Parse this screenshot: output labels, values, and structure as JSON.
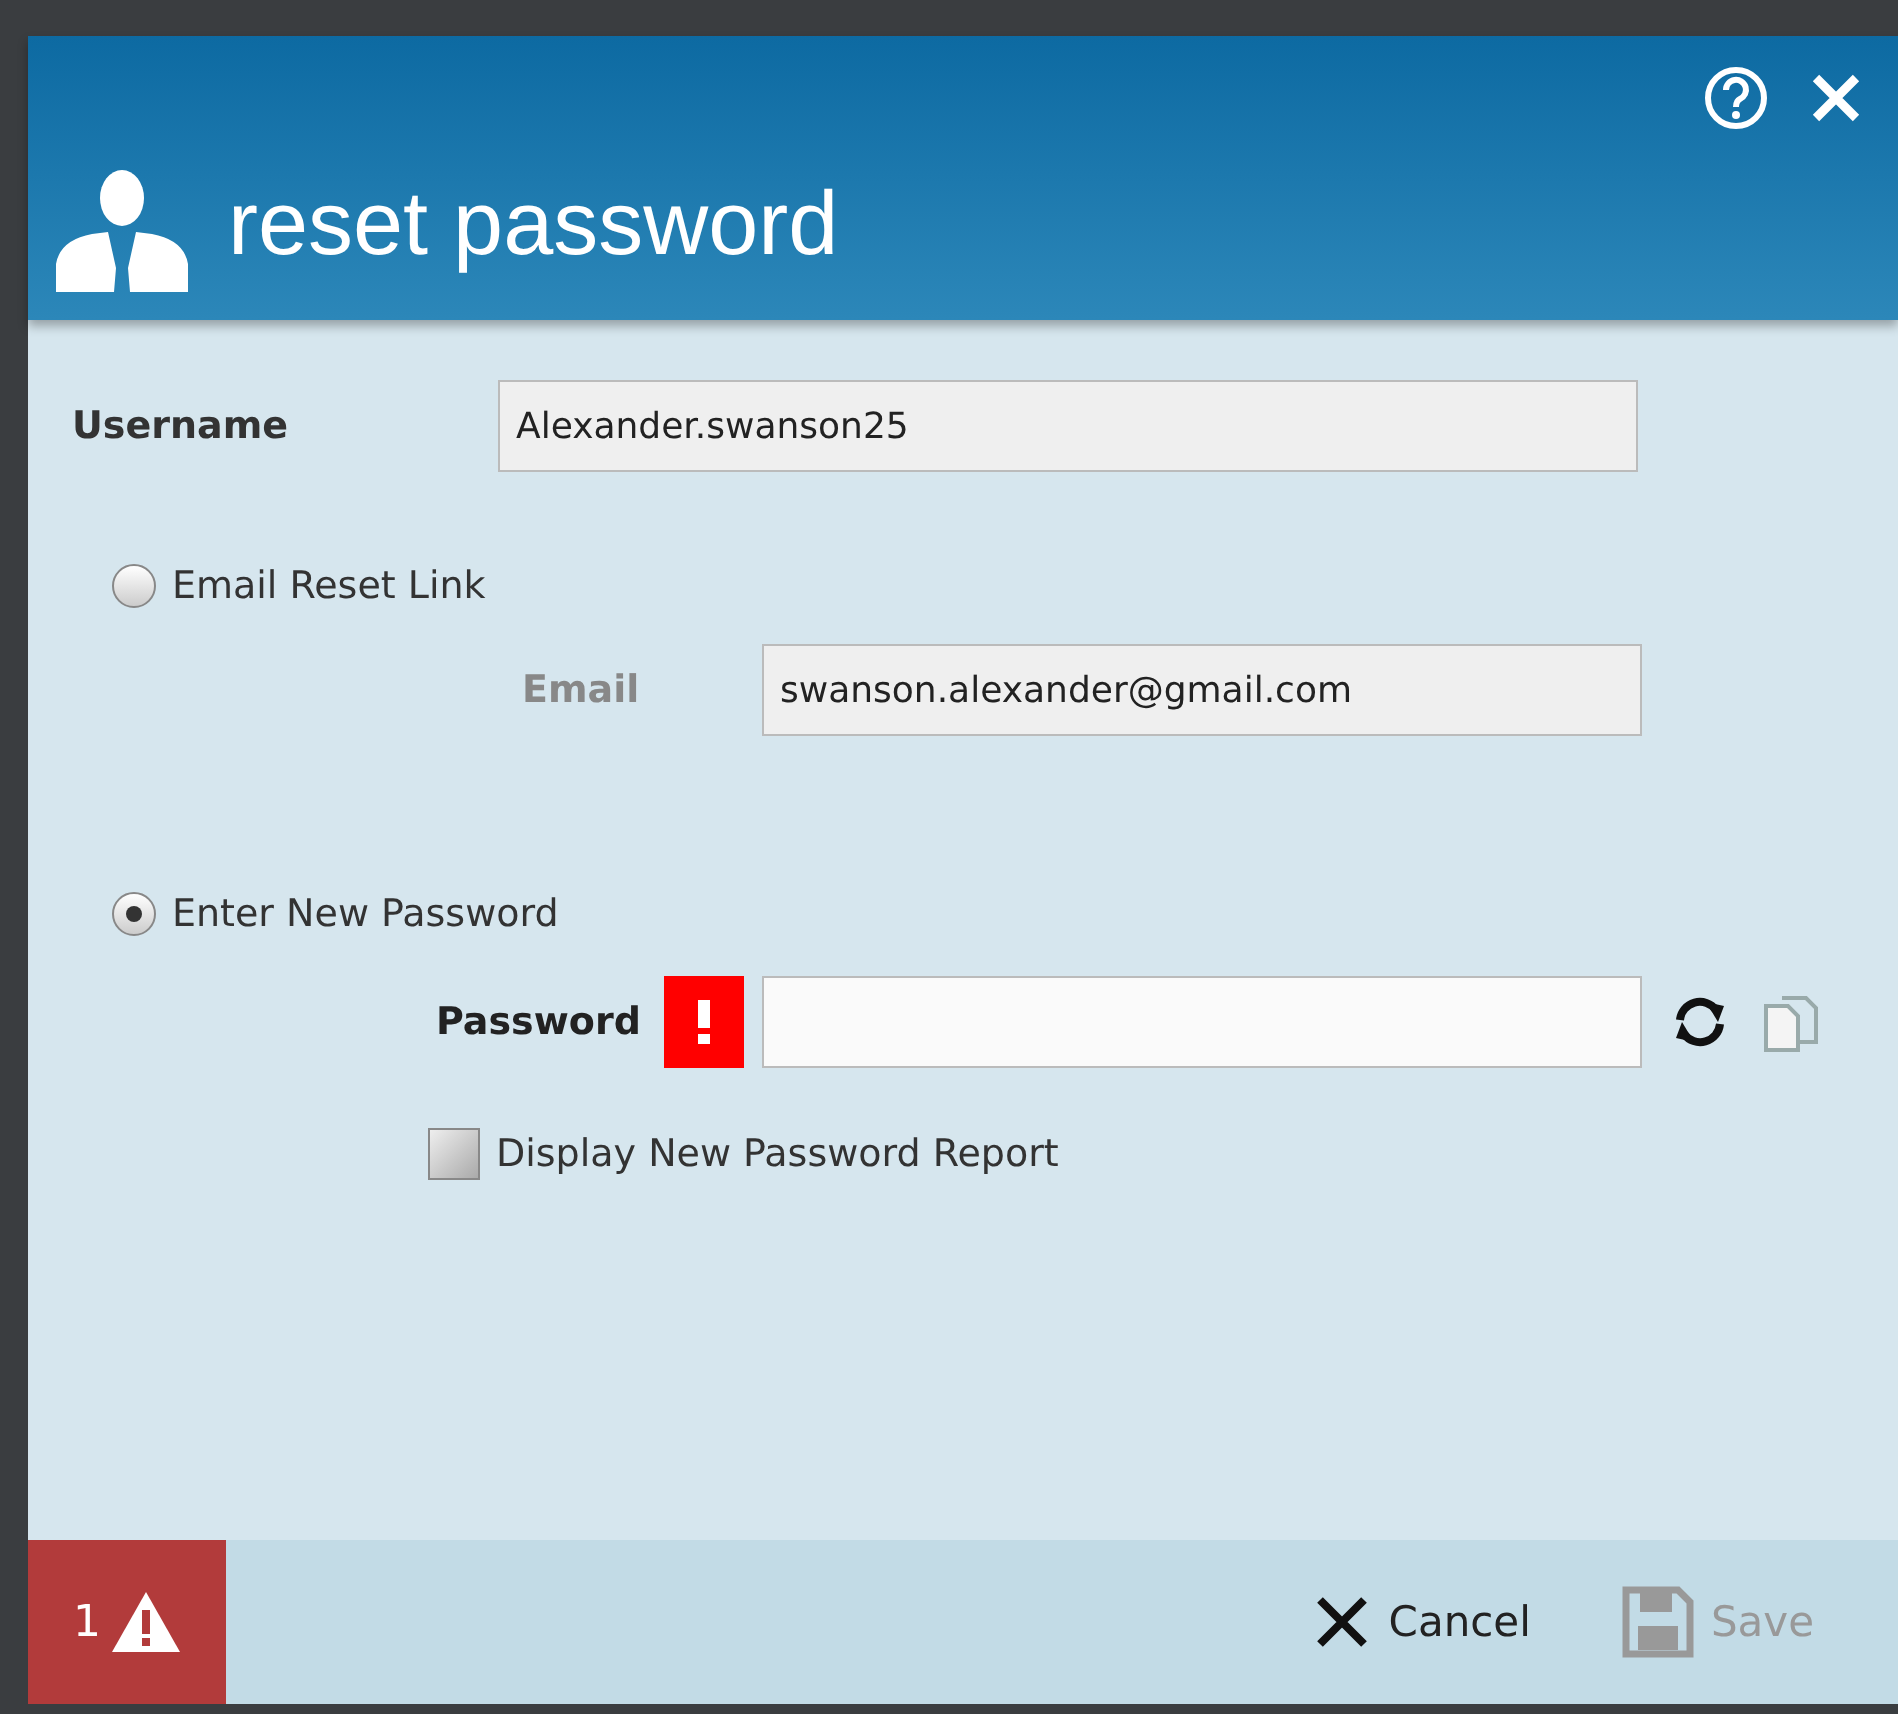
{
  "dialog": {
    "title": "reset password"
  },
  "username": {
    "label": "Username",
    "value": "Alexander.swanson25"
  },
  "options": [
    {
      "label": "Email Reset Link",
      "selected": false,
      "field": {
        "label": "Email",
        "value": "swanson.alexander@gmail.com"
      }
    },
    {
      "label": "Enter New Password",
      "selected": true,
      "field": {
        "label": "Password",
        "error": true
      }
    }
  ],
  "report_checkbox": {
    "label": "Display New Password Report",
    "checked": false
  },
  "footer": {
    "error_count": "1",
    "cancel": {
      "label": "Cancel"
    },
    "save": {
      "label": "Save",
      "disabled": true
    }
  }
}
